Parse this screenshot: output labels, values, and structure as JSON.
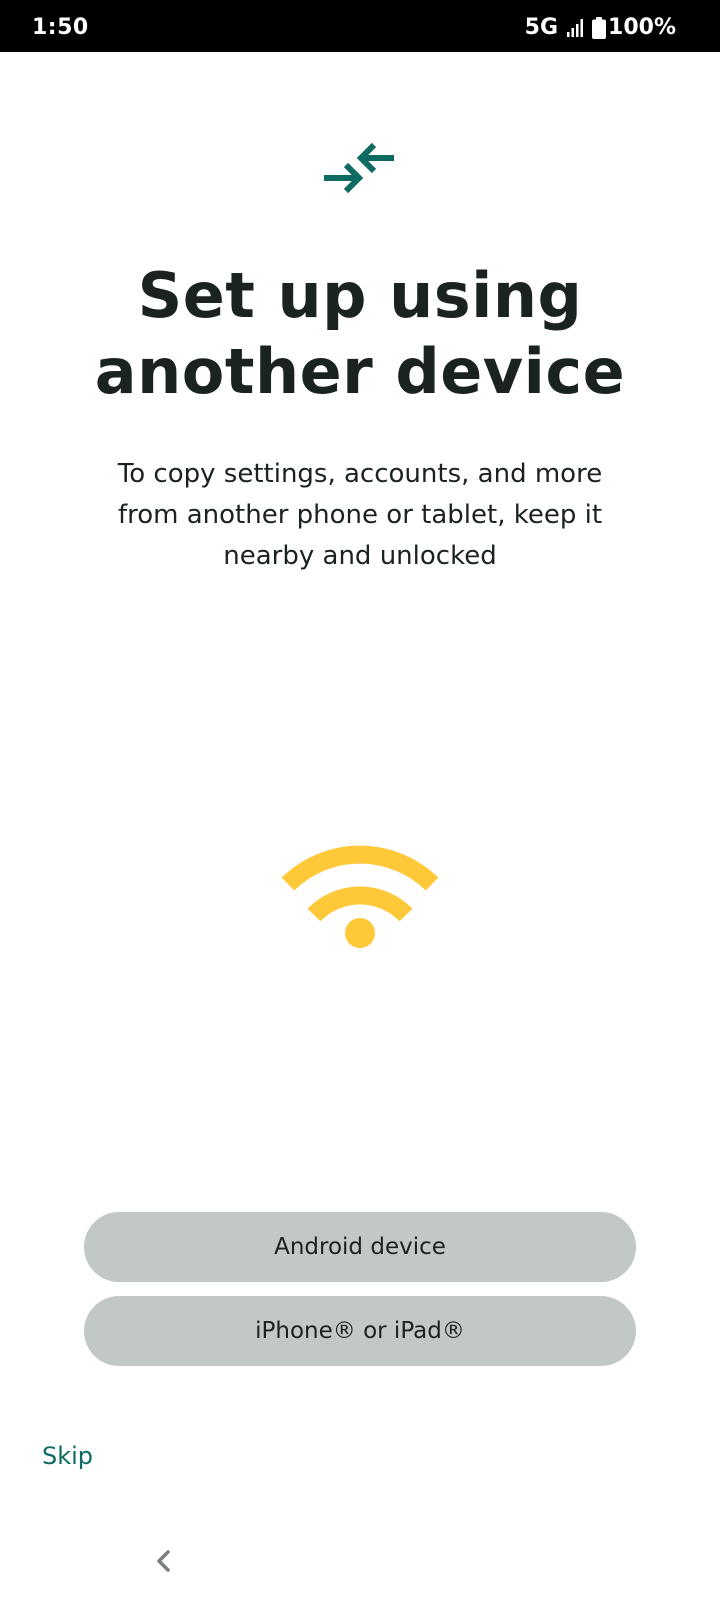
{
  "status_bar": {
    "time": "1:50",
    "network": "5G",
    "battery": "100%"
  },
  "icons": {
    "transfer": "transfer-arrows-icon",
    "wifi": "wifi-icon",
    "back": "chevron-left-icon"
  },
  "colors": {
    "accent": "#0d6b62",
    "wifi": "#ffc838",
    "button_bg": "#c2c8c6",
    "text": "#1b2222"
  },
  "main": {
    "title": "Set up using another device",
    "subtitle": "To copy settings, accounts, and more from another phone or tablet, keep it nearby and unlocked"
  },
  "buttons": {
    "android": "Android device",
    "iphone": "iPhone® or iPad®"
  },
  "footer": {
    "skip": "Skip"
  }
}
